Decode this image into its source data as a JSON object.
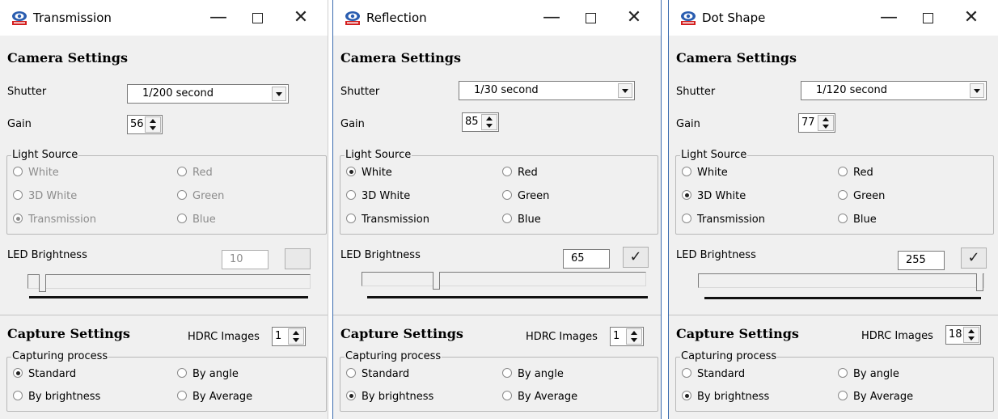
{
  "windows": [
    {
      "title": "Transmission",
      "camera_heading": "Camera Settings",
      "shutter_label": "Shutter",
      "shutter_value": "1/200 second",
      "gain_label": "Gain",
      "gain_value": "56",
      "light_source_label": "Light Source",
      "light_source_enabled": false,
      "light_options": [
        "White",
        "Red",
        "3D White",
        "Green",
        "Transmission",
        "Blue"
      ],
      "light_selected": "Transmission",
      "led_label": "LED Brightness",
      "led_value": "10",
      "led_ok_label": "",
      "led_level": 0.039,
      "capture_heading": "Capture Settings",
      "hdrc_label": "HDRC Images",
      "hdrc_value": "1",
      "process_label": "Capturing process",
      "process_options": [
        "Standard",
        "By angle",
        "By brightness",
        "By Average"
      ],
      "process_selected": "Standard"
    },
    {
      "title": "Reflection",
      "camera_heading": "Camera Settings",
      "shutter_label": "Shutter",
      "shutter_value": "1/30 second",
      "gain_label": "Gain",
      "gain_value": "85",
      "light_source_label": "Light Source",
      "light_source_enabled": true,
      "light_options": [
        "White",
        "Red",
        "3D White",
        "Green",
        "Transmission",
        "Blue"
      ],
      "light_selected": "White",
      "led_label": "LED Brightness",
      "led_value": "65",
      "led_ok_label": "✓",
      "led_level": 0.255,
      "capture_heading": "Capture Settings",
      "hdrc_label": "HDRC Images",
      "hdrc_value": "1",
      "process_label": "Capturing process",
      "process_options": [
        "Standard",
        "By angle",
        "By brightness",
        "By Average"
      ],
      "process_selected": "By brightness"
    },
    {
      "title": "Dot Shape",
      "camera_heading": "Camera Settings",
      "shutter_label": "Shutter",
      "shutter_value": "1/120 second",
      "gain_label": "Gain",
      "gain_value": "77",
      "light_source_label": "Light Source",
      "light_source_enabled": true,
      "light_options": [
        "White",
        "Red",
        "3D White",
        "Green",
        "Transmission",
        "Blue"
      ],
      "light_selected": "3D White",
      "led_label": "LED Brightness",
      "led_value": "255",
      "led_ok_label": "✓",
      "led_level": 1.0,
      "capture_heading": "Capture Settings",
      "hdrc_label": "HDRC Images",
      "hdrc_value": "18",
      "process_label": "Capturing process",
      "process_options": [
        "Standard",
        "By angle",
        "By brightness",
        "By Average"
      ],
      "process_selected": "By brightness"
    }
  ],
  "icons": {
    "app": "camera-logo-icon",
    "minimize": "minimize-icon",
    "maximize": "maximize-icon",
    "close": "close-icon",
    "dropdown": "chevron-down-icon",
    "spinner": "spin-arrows-icon",
    "ok": "checkmark-icon"
  },
  "colors": {
    "window_bg": "#f0f0f0",
    "titlebar_bg": "#ffffff",
    "active_border": "#3c6db0",
    "disabled_text": "#8c8c8c"
  }
}
